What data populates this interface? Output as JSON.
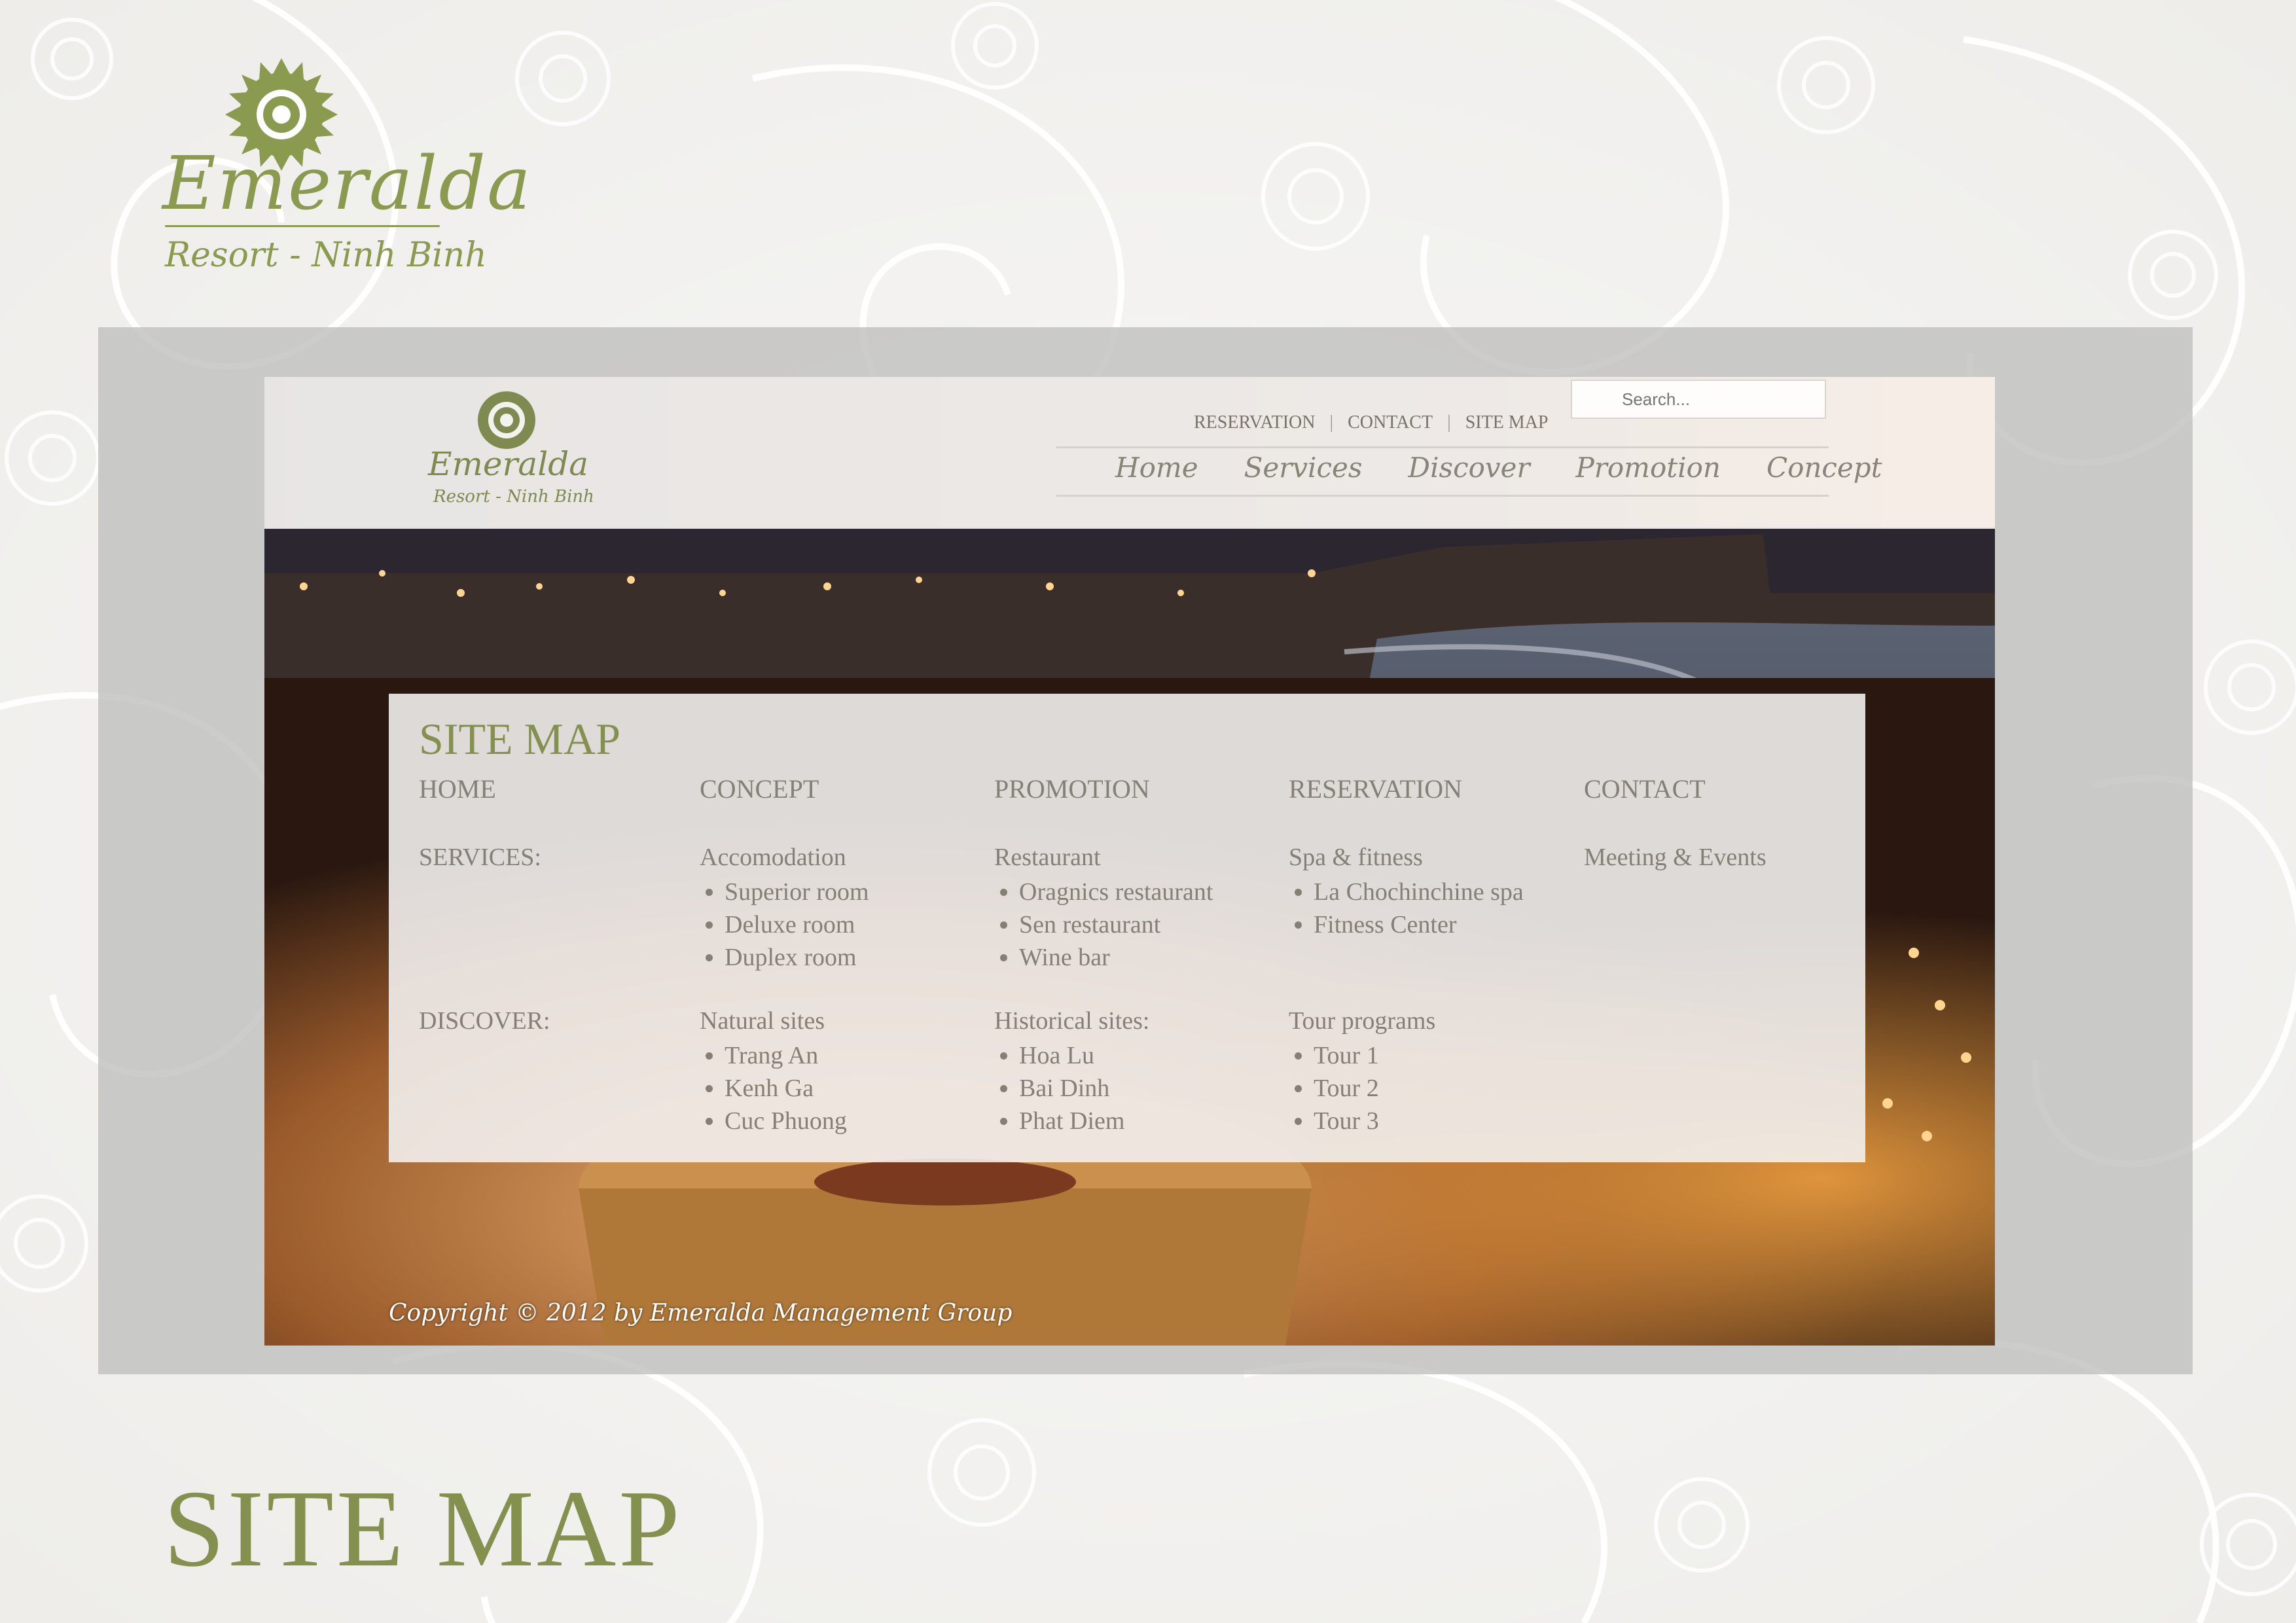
{
  "colors": {
    "brand_green": "#84904e",
    "panel_bg": "#f2f0ee",
    "text_gray": "#857f75"
  },
  "brand": {
    "name": "Emeralda",
    "tagline": "Resort - Ninh Binh"
  },
  "site": {
    "logo": {
      "name": "Emeralda",
      "tagline": "Resort - Ninh Binh"
    },
    "top_links": [
      "RESERVATION",
      "CONTACT",
      "SITE MAP"
    ],
    "search_placeholder": "Search...",
    "nav": [
      "Home",
      "Services",
      "Discover",
      "Promotion",
      "Concept"
    ],
    "sitemap": {
      "title": "SITE MAP",
      "top_row": [
        "HOME",
        "CONCEPT",
        "PROMOTION",
        "RESERVATION",
        "CONTACT"
      ],
      "services_label": "SERVICES:",
      "services": [
        {
          "heading": "Accomodation",
          "items": [
            "Superior room",
            "Deluxe room",
            "Duplex room"
          ]
        },
        {
          "heading": "Restaurant",
          "items": [
            "Oragnics restaurant",
            "Sen restaurant",
            "Wine bar"
          ]
        },
        {
          "heading": "Spa & fitness",
          "items": [
            "La Chochinchine spa",
            "Fitness Center"
          ]
        },
        {
          "heading": "Meeting & Events",
          "items": []
        }
      ],
      "discover_label": "DISCOVER:",
      "discover": [
        {
          "heading": "Natural sites",
          "items": [
            "Trang An",
            "Kenh Ga",
            "Cuc Phuong"
          ]
        },
        {
          "heading": "Historical sites:",
          "items": [
            "Hoa Lu",
            "Bai Dinh",
            "Phat Diem"
          ]
        },
        {
          "heading": "Tour programs",
          "items": [
            "Tour 1",
            "Tour 2",
            "Tour 3"
          ]
        }
      ]
    },
    "copyright": "Copyright © 2012 by Emeralda Management Group"
  },
  "slide_title": "SITE MAP"
}
